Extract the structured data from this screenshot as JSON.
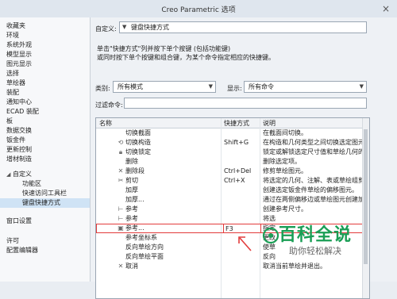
{
  "window": {
    "title": "Creo Parametric 选项",
    "close": "×"
  },
  "sidebar": {
    "items": [
      {
        "label": "收藏夹"
      },
      {
        "label": "环境"
      },
      {
        "label": "系统外观"
      },
      {
        "label": "模型显示"
      },
      {
        "label": "图元显示"
      },
      {
        "label": "选择"
      },
      {
        "label": "草绘器"
      },
      {
        "label": "装配"
      },
      {
        "label": "通知中心"
      },
      {
        "label": "ECAD 装配"
      },
      {
        "label": "板"
      },
      {
        "label": "数据交换"
      },
      {
        "label": "钣金件"
      },
      {
        "label": "更新控制"
      },
      {
        "label": "增材制造"
      }
    ],
    "group": {
      "label": "自定义",
      "toggle": "◢"
    },
    "sub_items": [
      {
        "label": "功能区"
      },
      {
        "label": "快速访问工具栏"
      },
      {
        "label": "键盘快捷方式"
      }
    ],
    "bottom_items": [
      {
        "label": "窗口设置"
      },
      {
        "label": "许可"
      },
      {
        "label": "配置编辑器"
      }
    ]
  },
  "main": {
    "customize_label": "自定义:",
    "customize_value": "键盘快捷方式",
    "hint_lines": [
      "单击\"快捷方式\"列并按下单个按键 (包括功能键)",
      "或同时按下单个按键和组合键，为某个命令指定相应的快捷键。"
    ],
    "category_label": "类别:",
    "category_value": "所有模式",
    "display_label": "显示:",
    "display_value": "所有命令",
    "filter_label": "过滤命令:",
    "filter_value": ""
  },
  "table": {
    "headers": {
      "name": "名称",
      "shortcut": "快捷方式",
      "description": "说明"
    },
    "rows": [
      {
        "icon": "none",
        "name": "切换截面",
        "shortcut": "",
        "desc": "在截面间切换。"
      },
      {
        "icon": "toggle-construction-icon",
        "name": "切换构造",
        "shortcut": "Shift+G",
        "desc": "在构造和几何类型之间切换选定图元。"
      },
      {
        "icon": "lock-icon",
        "name": "切换锁定",
        "shortcut": "",
        "desc": "锁定或解锁选定尺寸值和草绘几何的锁"
      },
      {
        "icon": "none",
        "name": "删除",
        "shortcut": "",
        "desc": "删除选定项。"
      },
      {
        "icon": "delete-segment-icon",
        "name": "删除段",
        "shortcut": "Ctrl+Del",
        "desc": "修剪草绘图元。"
      },
      {
        "icon": "scissors-icon",
        "name": "剪切",
        "shortcut": "Ctrl+X",
        "desc": "将选定的几何、注解、表或草绘组剪切"
      },
      {
        "icon": "none",
        "name": "加厚",
        "shortcut": "",
        "desc": "创建选定钣金件草绘的偏移图元。"
      },
      {
        "icon": "none",
        "name": "加厚...",
        "shortcut": "",
        "desc": "通过在两侧偏移边或草绘图元创建加"
      },
      {
        "icon": "reference-icon",
        "name": "参考",
        "shortcut": "",
        "desc": "创建参考尺寸。"
      },
      {
        "icon": "reference-icon",
        "name": "参考",
        "shortcut": "",
        "desc": "将选"
      },
      {
        "icon": "reference-dialog-icon",
        "name": "参考...",
        "shortcut": "F3",
        "desc": "指定"
      },
      {
        "icon": "none",
        "name": "参考坐标系",
        "shortcut": "",
        "desc": "更改"
      },
      {
        "icon": "none",
        "name": "反向草绘方向",
        "shortcut": "",
        "desc": "使草"
      },
      {
        "icon": "none",
        "name": "反向草绘平面",
        "shortcut": "",
        "desc": "反向"
      },
      {
        "icon": "cancel-icon",
        "name": "取消",
        "shortcut": "",
        "desc": "取消当前草绘并退出。"
      }
    ]
  },
  "watermark": {
    "main": "百科全说",
    "sub": "助你轻松解决"
  },
  "colors": {
    "selected_bg": "#cfe3f5",
    "highlight_border": "#e23b3b",
    "watermark_green": "#1a9e55"
  }
}
